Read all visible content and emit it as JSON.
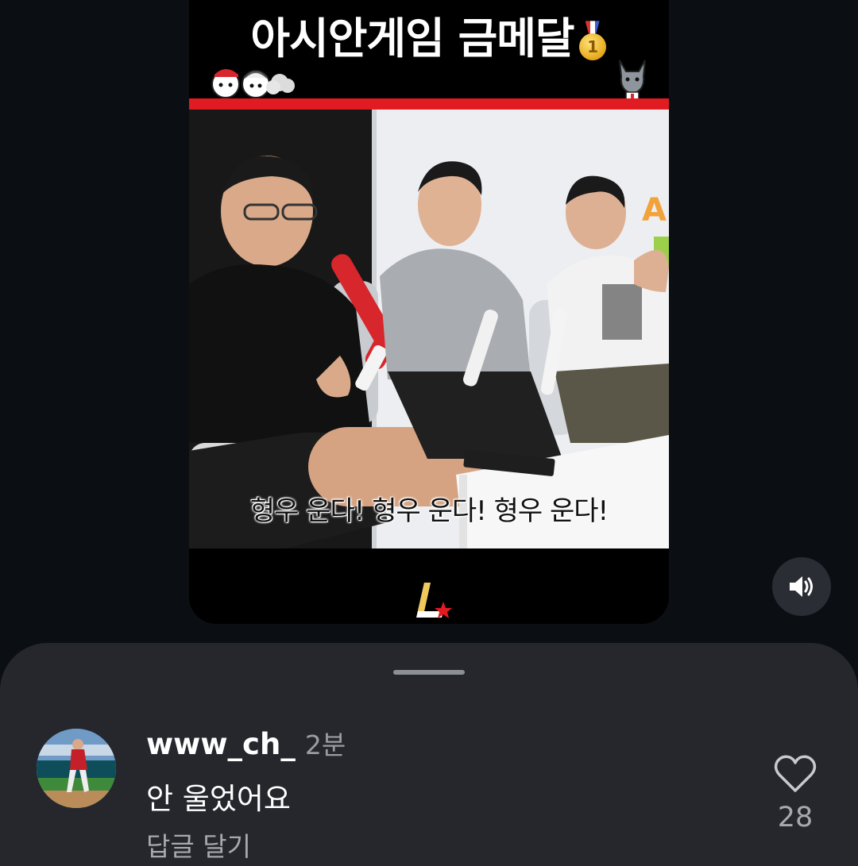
{
  "video": {
    "title": "아시안게임 금메달",
    "medal_number": "1",
    "subtitle": "형우 운다! 형우 운다! 형우 운다!",
    "brand_mark": "L"
  },
  "controls": {
    "sound_icon": "speaker-volume-icon"
  },
  "comment": {
    "username": "www_ch_",
    "timestamp": "2분",
    "text": "안 울었어요",
    "reply_label": "답글 달기",
    "like_count": "28",
    "like_icon": "heart-outline-icon"
  },
  "colors": {
    "background": "#0b0f14",
    "sheet": "#25272c",
    "accent_red": "#e01b22",
    "muted_text": "#9a9ca1"
  }
}
